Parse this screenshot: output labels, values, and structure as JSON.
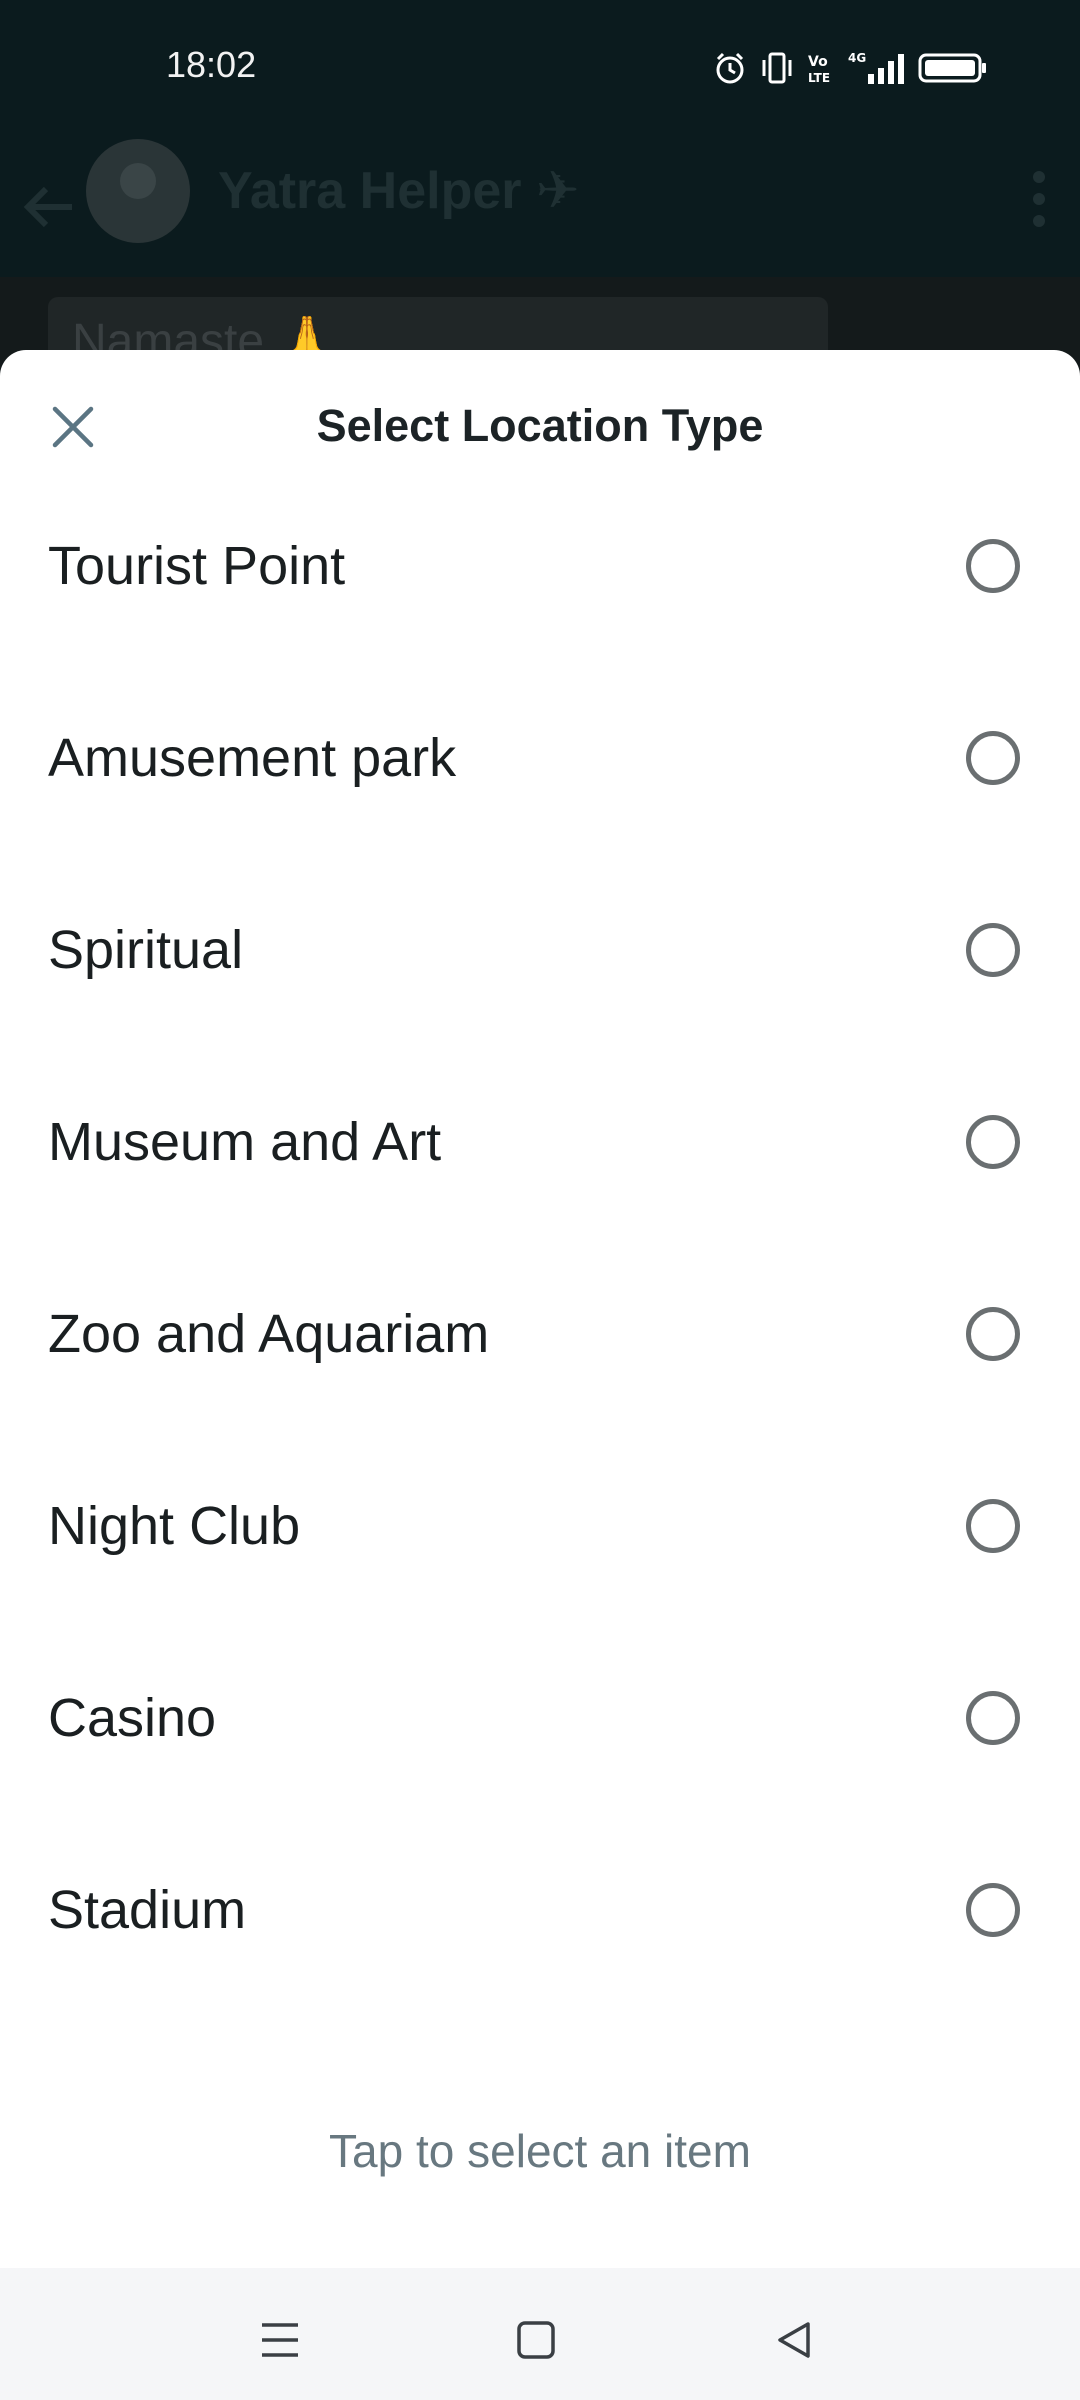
{
  "status_bar": {
    "time": "18:02",
    "icons": [
      "alarm-icon",
      "vibrate-icon",
      "volte-icon",
      "signal-4g-icon",
      "battery-icon"
    ]
  },
  "chat": {
    "title": "Yatra Helper ✈",
    "first_message": "Namaste 🙏"
  },
  "sheet": {
    "title": "Select Location Type",
    "options": [
      {
        "label": "Tourist Point",
        "selected": false
      },
      {
        "label": "Amusement park",
        "selected": false
      },
      {
        "label": "Spiritual",
        "selected": false
      },
      {
        "label": "Museum and Art",
        "selected": false
      },
      {
        "label": "Zoo and Aquariam",
        "selected": false
      },
      {
        "label": "Night Club",
        "selected": false
      },
      {
        "label": "Casino",
        "selected": false
      },
      {
        "label": "Stadium",
        "selected": false
      }
    ],
    "footer": "Tap to select an item"
  },
  "colors": {
    "header_bg": "#0b1b1e",
    "sheet_bg": "#ffffff",
    "radio_border": "#6a6f71",
    "footer_text": "#687880"
  }
}
